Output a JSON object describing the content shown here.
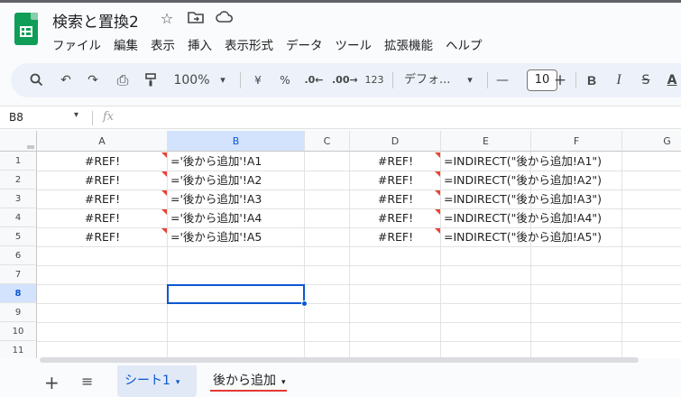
{
  "app": {
    "title": "検索と置換2",
    "title_icons": [
      "star-icon",
      "move-to-folder-icon",
      "cloud-status-icon"
    ]
  },
  "menu": [
    "ファイル",
    "編集",
    "表示",
    "挿入",
    "表示形式",
    "データ",
    "ツール",
    "拡張機能",
    "ヘルプ"
  ],
  "toolbar": {
    "search": "🔍",
    "undo": "↶",
    "redo": "↷",
    "print": "⎙",
    "paint_format": "🖌",
    "zoom": "100%",
    "zoom_arrow": "▾",
    "currency": "¥",
    "percent": "%",
    "decimal_decrease": ".0←",
    "decimal_increase": ".00→",
    "number_format": "123",
    "font": "デフォ...",
    "font_arrow": "▾",
    "font_size_decrease": "—",
    "font_size": "10",
    "font_size_increase": "+",
    "bold": "B",
    "italic": "I",
    "strikethrough": "S",
    "text_color": "A"
  },
  "formula_bar": {
    "name_box": "B8",
    "name_box_arrow": "▾",
    "fx": "fx"
  },
  "grid": {
    "columns": [
      "A",
      "B",
      "C",
      "D",
      "E",
      "F",
      "G"
    ],
    "selected_column": "B",
    "rows": [
      "1",
      "2",
      "3",
      "4",
      "5",
      "6",
      "7",
      "8",
      "9",
      "10",
      "11"
    ],
    "selected_row": "8",
    "selected_cell": "B8",
    "cells": [
      {
        "row": 1,
        "A": "#REF!",
        "B": "='後から追加'!A1",
        "D": "#REF!",
        "E": "=INDIRECT(\"後から追加!A1\")"
      },
      {
        "row": 2,
        "A": "#REF!",
        "B": "='後から追加'!A2",
        "D": "#REF!",
        "E": "=INDIRECT(\"後から追加!A2\")"
      },
      {
        "row": 3,
        "A": "#REF!",
        "B": "='後から追加'!A3",
        "D": "#REF!",
        "E": "=INDIRECT(\"後から追加!A3\")"
      },
      {
        "row": 4,
        "A": "#REF!",
        "B": "='後から追加'!A4",
        "D": "#REF!",
        "E": "=INDIRECT(\"後から追加!A4\")"
      },
      {
        "row": 5,
        "A": "#REF!",
        "B": "='後から追加'!A5",
        "D": "#REF!",
        "E": "=INDIRECT(\"後から追加!A5\")"
      }
    ]
  },
  "sheet_tabs": {
    "add_icon": "+",
    "all_sheets_icon": "≡",
    "tabs": [
      {
        "label": "シート1",
        "active": true,
        "arrow": "▾"
      },
      {
        "label": "後から追加",
        "active": false,
        "arrow": "▾"
      }
    ]
  },
  "colors": {
    "accent": "#0b57d0",
    "error_marker": "#ea4335",
    "sheets_green": "#0f9d58",
    "tab_underline": "#e53935"
  }
}
